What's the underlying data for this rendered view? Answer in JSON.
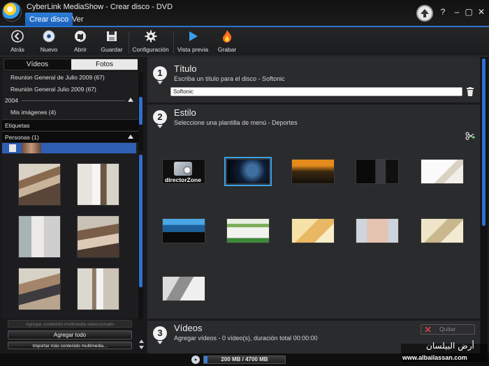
{
  "window": {
    "title": "CyberLink MediaShow - Crear disco - DVD",
    "controls": [
      "?",
      "–",
      "▢",
      "✕"
    ]
  },
  "menu": {
    "tabs": [
      {
        "label": "Crear disco",
        "active": true
      },
      {
        "label": "Ver",
        "active": false
      }
    ]
  },
  "toolbar": {
    "buttons": [
      {
        "label": "Atrás",
        "icon": "back-arrow-icon"
      },
      {
        "label": "Nuevo",
        "icon": "disc-icon"
      },
      {
        "label": "Abrir",
        "icon": "open-folder-icon"
      },
      {
        "label": "Guardar",
        "icon": "floppy-save-icon"
      },
      {
        "label": "Configuración",
        "icon": "gear-icon"
      },
      {
        "label": "Vista previa",
        "icon": "play-icon"
      },
      {
        "label": "Grabar",
        "icon": "flame-icon"
      }
    ]
  },
  "library": {
    "tabs": [
      {
        "label": "Vídeos",
        "selected": false
      },
      {
        "label": "Fotos",
        "selected": true
      }
    ],
    "albums": [
      "Reunion General de Julio 2009 (67)",
      "Reunión General Julio 2009 (67)"
    ],
    "year": "2004",
    "my_images": "Mis imágenes (4)",
    "tags_header": "Etiquetas",
    "people_header": "Personas (1)",
    "add_selected": "Agregar contenido multimedia seleccionado",
    "add_all": "Agregar todo",
    "import_more": "Importar más contenido multimedia..."
  },
  "steps": {
    "title": {
      "number": "1",
      "heading": "Título",
      "description": "Escriba un título para el disco - Softonic",
      "value": "Softonic"
    },
    "style": {
      "number": "2",
      "heading": "Estilo",
      "description": "Seleccione una plantilla de menú - Deportes",
      "director_zone_label": "directorZone",
      "selected_template_index": 1
    },
    "videos": {
      "number": "3",
      "heading": "Vídeos",
      "description": "Agregar vídeos - 0 vídeo(s), duración total 00:00:00",
      "remove_label": "Quitar"
    }
  },
  "status": {
    "capacity": "200 MB / 4700 MB"
  },
  "watermark": {
    "arabic": "أرض البيلسان",
    "url": "www.albailassan.com"
  },
  "colors": {
    "accent": "#2b74cf",
    "selection": "#3ba3e8"
  }
}
